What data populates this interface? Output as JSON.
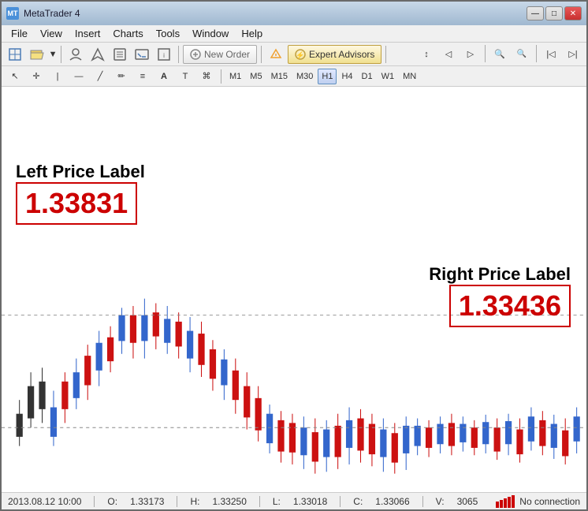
{
  "window": {
    "title": "MetaTrader 4",
    "icon": "MT"
  },
  "titlebar": {
    "controls": {
      "minimize": "—",
      "maximize": "□",
      "close": "✕"
    }
  },
  "menubar": {
    "items": [
      "File",
      "View",
      "Insert",
      "Charts",
      "Tools",
      "Window",
      "Help"
    ]
  },
  "toolbar": {
    "new_order_label": "New Order",
    "expert_advisors_label": "Expert Advisors"
  },
  "timeframes": {
    "items": [
      "M1",
      "M5",
      "M15",
      "M30",
      "H1",
      "H4",
      "D1",
      "W1",
      "MN"
    ],
    "active": "H1"
  },
  "chart": {
    "left_label_title": "Left Price Label",
    "left_label_value": "1.33831",
    "right_label_title": "Right Price Label",
    "right_label_value": "1.33436"
  },
  "statusbar": {
    "datetime": "2013.08.12 10:00",
    "open_label": "O:",
    "open_value": "1.33173",
    "high_label": "H:",
    "high_value": "1.33250",
    "low_label": "L:",
    "low_value": "1.33018",
    "close_label": "C:",
    "close_value": "1.33066",
    "volume_label": "V:",
    "volume_value": "3065",
    "connection": "No connection"
  }
}
